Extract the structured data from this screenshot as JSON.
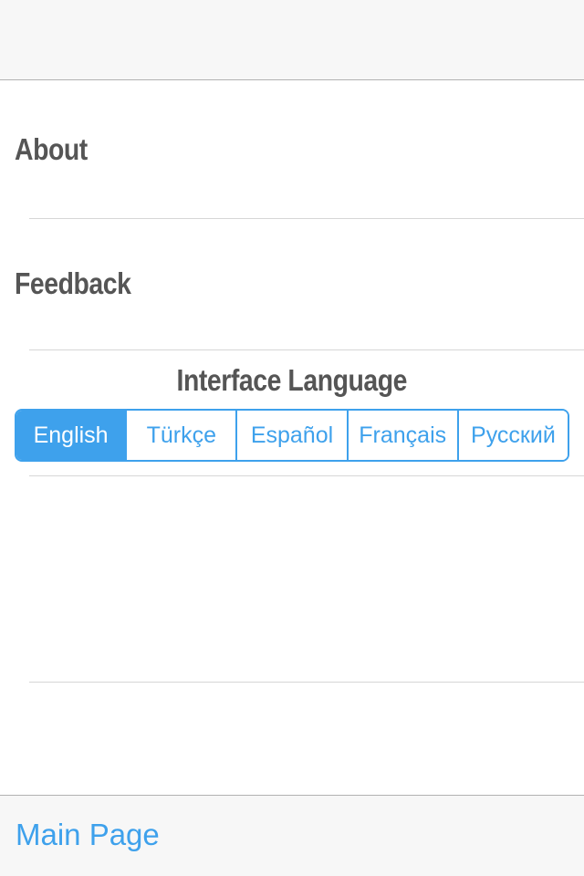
{
  "menu": {
    "about_label": "About",
    "feedback_label": "Feedback"
  },
  "language": {
    "title": "Interface Language",
    "options": [
      "English",
      "Türkçe",
      "Español",
      "Français",
      "Русский"
    ],
    "selected": "English"
  },
  "footer": {
    "main_page_label": "Main Page"
  },
  "colors": {
    "accent": "#3ea1ec",
    "label_text": "#555555",
    "bar_background": "#f7f7f7",
    "separator": "#d6d6d6"
  }
}
